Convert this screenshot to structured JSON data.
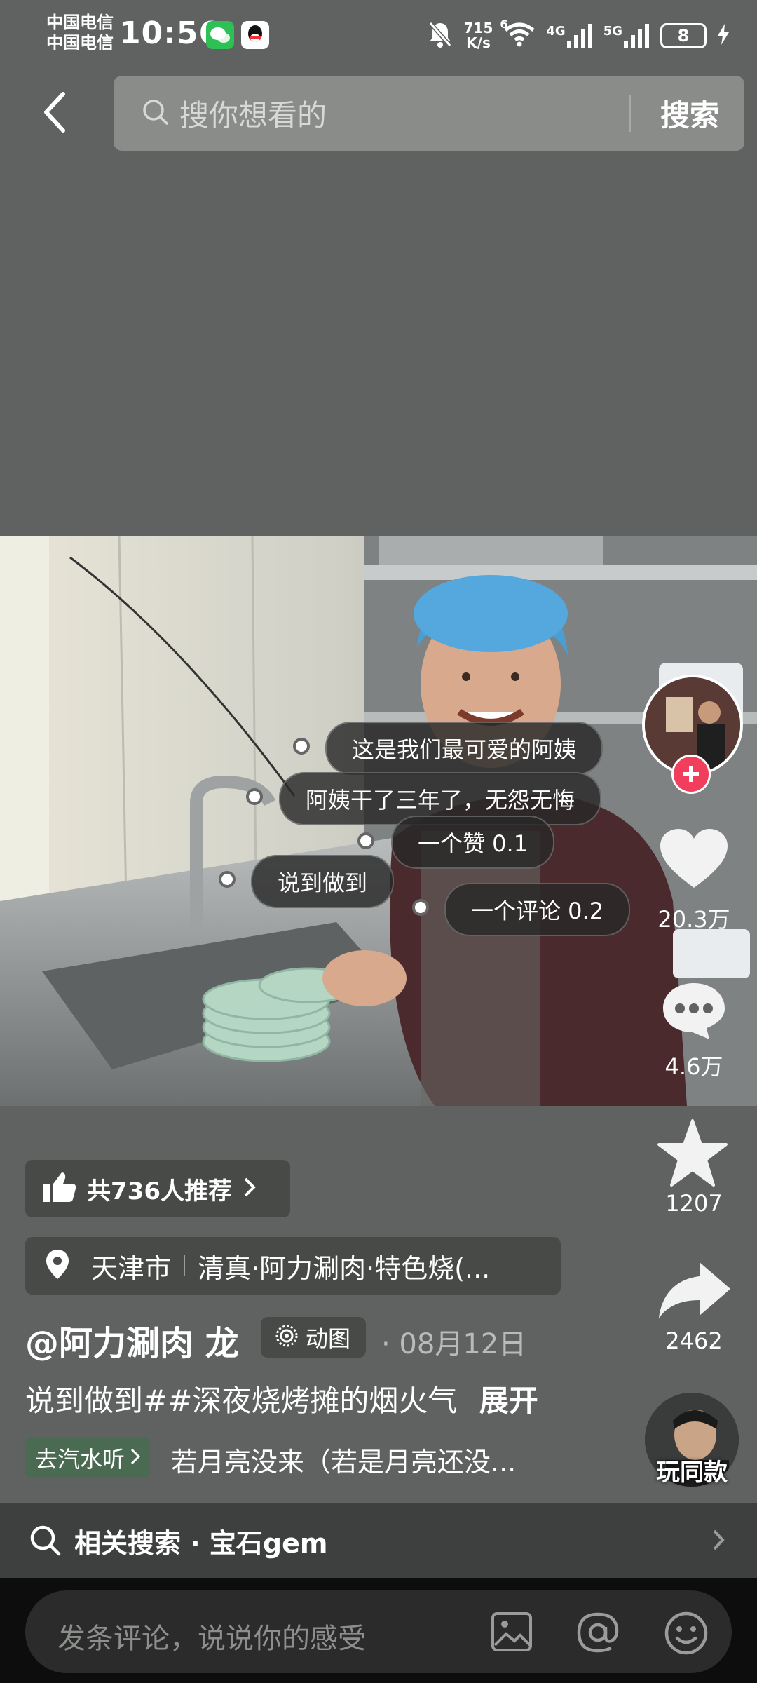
{
  "status": {
    "carrier1": "中国电信",
    "carrier2": "中国电信",
    "time": "10:56",
    "speed_top": "715",
    "speed_unit": "K/s",
    "wifi_badge": "6",
    "net1": "4G",
    "net2": "5G",
    "battery": "8"
  },
  "search": {
    "placeholder": "搜你想看的",
    "button": "搜索"
  },
  "overlay": {
    "b1": "这是我们最可爱的阿姨",
    "b2": "阿姨干了三年了，无怨无悔",
    "b3": "一个赞 0.1",
    "b4": "说到做到",
    "b5": "一个评论 0.2"
  },
  "rail": {
    "likes": "20.3万",
    "comments": "4.6万",
    "favorites": "1207",
    "shares": "2462",
    "same_style": "玩同款"
  },
  "info": {
    "recommend": "共736人推荐",
    "location_city": "天津市",
    "location_place": "清真·阿力涮肉·特色烧(...",
    "author": "@阿力涮肉 龙",
    "tag": "动图",
    "date": "· 08月12日",
    "caption": "说到做到##深夜烧烤摊的烟火气",
    "expand": "展开",
    "music_tag": "去汽水听",
    "music": "若月亮没来（若是月亮还没...",
    "related_prefix": "相关搜索 · ",
    "related": "宝石gem"
  },
  "comment": {
    "placeholder": "发条评论，说说你的感受"
  },
  "colors": {
    "follow": "#f03e5c",
    "background": "#5f6260"
  }
}
